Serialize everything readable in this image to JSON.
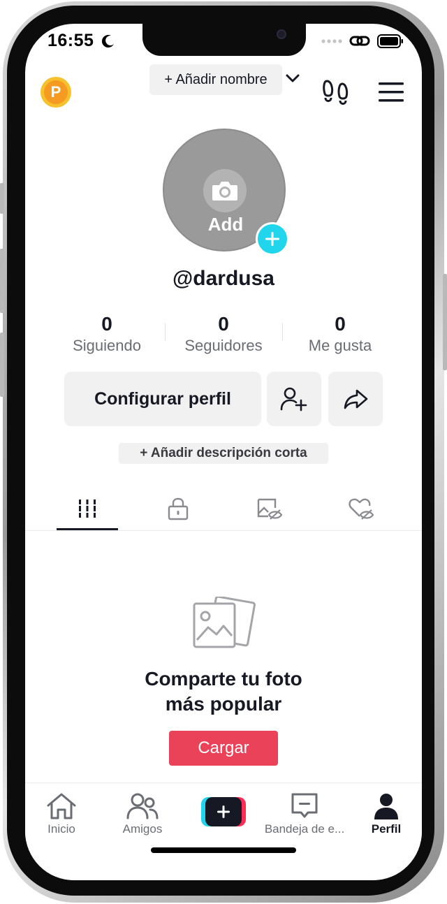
{
  "status_bar": {
    "time": "16:55"
  },
  "header": {
    "coin_letter": "P",
    "name_button": "+ Añadir nombre"
  },
  "profile": {
    "avatar_label": "Add",
    "username": "@dardusa",
    "stats": [
      {
        "value": "0",
        "label": "Siguiendo"
      },
      {
        "value": "0",
        "label": "Seguidores"
      },
      {
        "value": "0",
        "label": "Me gusta"
      }
    ],
    "edit_button": "Configurar perfil",
    "bio_button": "+ Añadir descripción corta"
  },
  "tabs": [
    {
      "icon": "grid-icon",
      "active": true
    },
    {
      "icon": "lock-icon",
      "active": false
    },
    {
      "icon": "hidden-posts-icon",
      "active": false
    },
    {
      "icon": "hidden-likes-icon",
      "active": false
    }
  ],
  "empty_state": {
    "title_line1": "Comparte tu foto",
    "title_line2": "más popular",
    "upload_button": "Cargar"
  },
  "bottom_nav": [
    {
      "label": "Inicio",
      "icon": "home-icon",
      "active": false
    },
    {
      "label": "Amigos",
      "icon": "friends-icon",
      "active": false
    },
    {
      "label": "",
      "icon": "create-icon",
      "active": false
    },
    {
      "label": "Bandeja de e...",
      "icon": "inbox-icon",
      "active": false
    },
    {
      "label": "Perfil",
      "icon": "profile-icon",
      "active": true
    }
  ],
  "colors": {
    "accent_red": "#ea4359",
    "cyan": "#20d5ec",
    "text_primary": "#161823",
    "text_secondary": "#6b6d75",
    "button_bg": "#f1f1f2"
  }
}
